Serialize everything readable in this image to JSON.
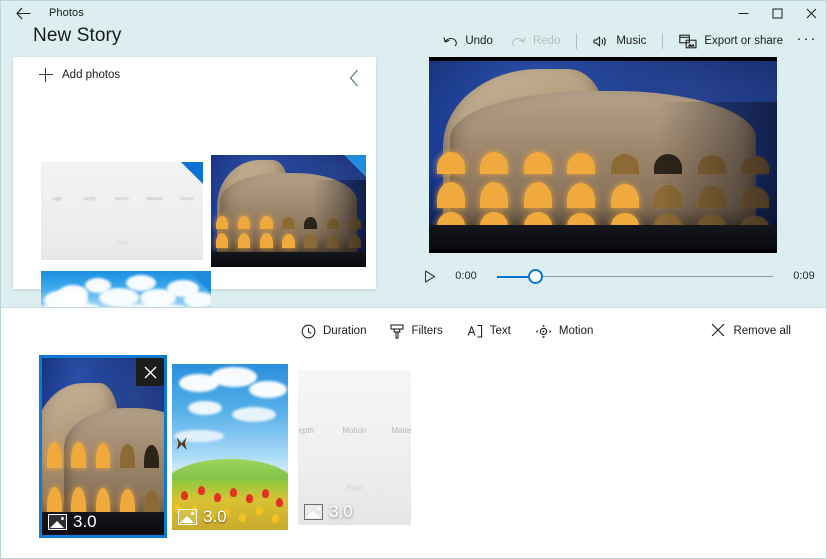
{
  "window": {
    "app_name": "Photos",
    "back_icon": "back-arrow-icon",
    "controls": {
      "minimize": "minimize-icon",
      "maximize": "maximize-icon",
      "close": "close-icon"
    }
  },
  "header": {
    "page_title": "New Story",
    "toolbar": {
      "undo": {
        "label": "Undo",
        "icon": "undo-icon",
        "enabled": true
      },
      "redo": {
        "label": "Redo",
        "icon": "redo-icon",
        "enabled": false
      },
      "music": {
        "label": "Music",
        "icon": "speaker-icon"
      },
      "export": {
        "label": "Export or share",
        "icon": "export-share-icon"
      },
      "overflow": {
        "label": "···",
        "icon": "ellipsis-icon"
      }
    }
  },
  "library": {
    "add_photos_label": "Add photos",
    "add_photos_icon": "plus-icon",
    "collapse_icon": "chevron-left-icon",
    "thumbnails": [
      {
        "name": "3d-icons-screenshot",
        "selected": true,
        "icon_labels": [
          "Light",
          "Depth",
          "Motion",
          "Material",
          "Scene"
        ],
        "sub_label": "Paint"
      },
      {
        "name": "colosseum-night",
        "selected": true
      },
      {
        "name": "blue-sky-clouds",
        "selected": true
      }
    ]
  },
  "preview": {
    "image_name": "colosseum-night-preview",
    "play_icon": "play-icon",
    "current_time": "0:00",
    "total_time": "0:09",
    "progress_percent": 14
  },
  "edit_toolbar": {
    "items": [
      {
        "label": "Duration",
        "icon": "clock-icon"
      },
      {
        "label": "Filters",
        "icon": "brush-icon"
      },
      {
        "label": "Text",
        "icon": "text-icon"
      },
      {
        "label": "Motion",
        "icon": "motion-icon"
      }
    ],
    "remove_all": {
      "label": "Remove all",
      "icon": "close-x-icon"
    }
  },
  "storyboard": {
    "cards": [
      {
        "name": "colosseum-night",
        "duration": "3.0",
        "selected": true,
        "remove_icon": "close-x-icon",
        "duration_icon": "photo-icon"
      },
      {
        "name": "tulip-field",
        "duration": "3.0",
        "selected": false,
        "duration_icon": "photo-icon"
      },
      {
        "name": "3d-icons-screenshot",
        "duration": "3.0",
        "selected": false,
        "duration_icon": "photo-icon",
        "visible_label": "Motion"
      }
    ]
  },
  "colors": {
    "accent": "#0d7bd4",
    "header_bg": "#dceef0",
    "panel_bg": "#ffffff"
  }
}
